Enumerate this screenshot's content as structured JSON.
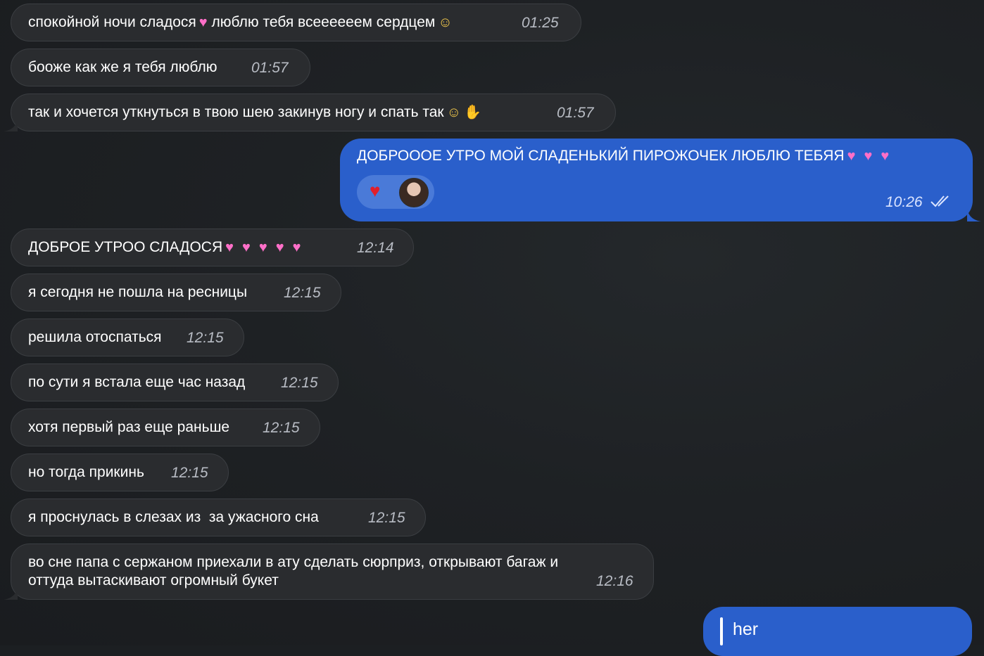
{
  "messages": [
    {
      "text": "спокойной ночи сладося",
      "text2": "люблю тебя всеееееем сердцем",
      "time": "01:25"
    },
    {
      "text": "бооже как же я тебя люблю",
      "time": "01:57"
    },
    {
      "text": "так и хочется уткнуться в твою шею закинув ногу и спать так",
      "time": "01:57"
    },
    {
      "text": "ДОБРОООЕ УТРО МОЙ СЛАДЕНЬКИЙ ПИРОЖОЧЕК ЛЮБЛЮ ТЕБЯЯ",
      "time": "10:26",
      "reaction": "heart"
    },
    {
      "text": "ДОБРОЕ УТРОО СЛАДОСЯ",
      "time": "12:14"
    },
    {
      "text": "я сегодня не пошла на ресницы",
      "time": "12:15"
    },
    {
      "text": "решила отоспаться",
      "time": "12:15"
    },
    {
      "text": "по сути я встала еще час назад",
      "time": "12:15"
    },
    {
      "text": "хотя первый раз еще раньше",
      "time": "12:15"
    },
    {
      "text": "но тогда прикинь",
      "time": "12:15"
    },
    {
      "text": "я проснулась в слезах из  за ужасного сна",
      "time": "12:15"
    },
    {
      "text": "во сне папа с сержаном приехали в ату сделать сюрприз, открывают багаж и",
      "text2": "оттуда вытаскивают огромный букет",
      "time": "12:16"
    }
  ],
  "composer": {
    "label": "her"
  },
  "icons": {
    "heart_emoji": "heart-emoji",
    "sneeze_emoji": "sneezing-face-emoji",
    "pinch_emoji": "pinching-hand-emoji",
    "read_ticks": "double-check-icon"
  },
  "colors": {
    "incoming_bubble": "#2a2c2f",
    "outgoing_bubble": "#2a5fcb",
    "background": "#1c1f22"
  }
}
